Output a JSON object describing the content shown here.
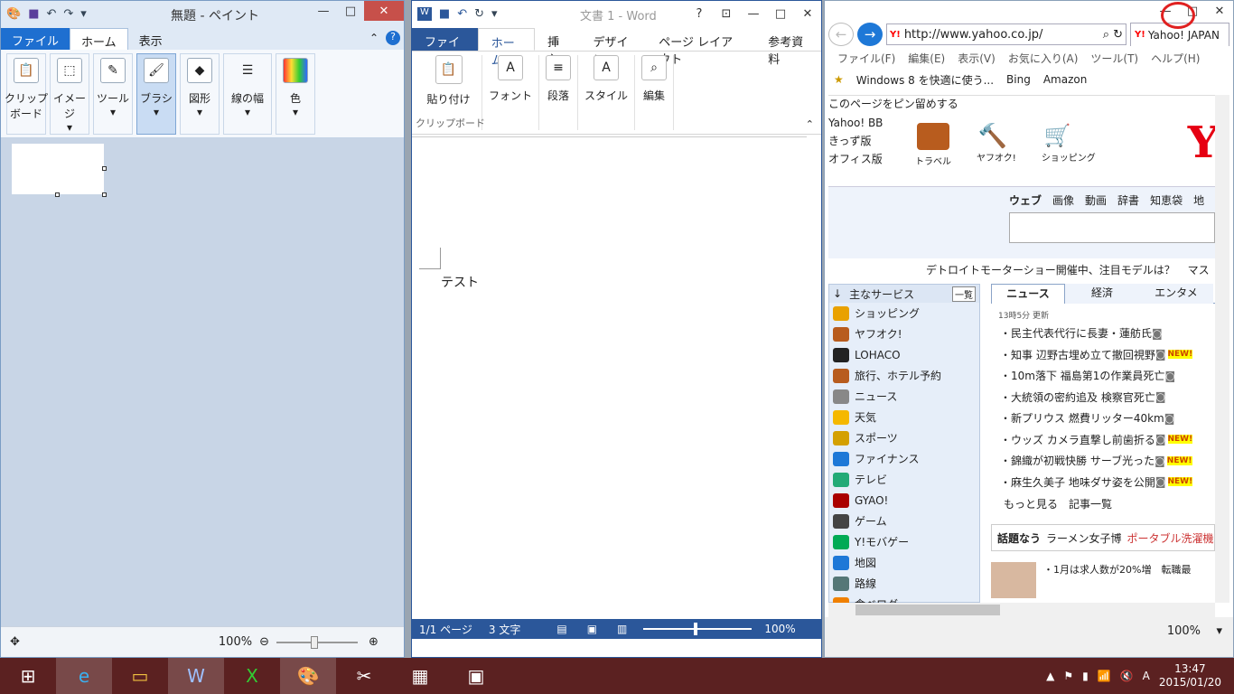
{
  "paint": {
    "title": "無題 - ペイント",
    "tabs": [
      "ファイル",
      "ホーム",
      "表示"
    ],
    "groups": [
      "クリップ\nボード",
      "イメージ",
      "ツール",
      "ブラシ",
      "図形",
      "線の幅",
      "色"
    ],
    "zoom": "100%"
  },
  "word": {
    "title": "文書 1 - Word",
    "help": "?",
    "tabs": [
      "ファイル",
      "ホーム",
      "挿入",
      "デザイン",
      "ページ レイアウト",
      "参考資料"
    ],
    "groups": [
      "貼り付け",
      "フォント",
      "段落",
      "スタイル",
      "編集"
    ],
    "clipboard_label": "クリップボード",
    "doc_text": "テスト",
    "page_status": "1/1 ページ",
    "word_count": "3 文字",
    "zoom": "100%"
  },
  "ie": {
    "url": "http://www.yahoo.co.jp/",
    "tab_title": "Yahoo! JAPAN",
    "menu": [
      "ファイル(F)",
      "編集(E)",
      "表示(V)",
      "お気に入り(A)",
      "ツール(T)",
      "ヘルプ(H)"
    ],
    "favorites": [
      "Windows 8 を快適に使う...",
      "Bing",
      "Amazon"
    ],
    "pin": "このページをピン留めする",
    "bb": [
      "Yahoo! BB",
      "きっず版",
      "オフィス版"
    ],
    "topicons": [
      "トラベル",
      "ヤフオク!",
      "ショッピング"
    ],
    "logo": "Y",
    "search_tabs": [
      "ウェブ",
      "画像",
      "動画",
      "辞書",
      "知恵袋",
      "地"
    ],
    "headline": "デトロイトモーターショー開催中、注目モデルは？",
    "headline2": "マス",
    "services_title": "主なサービス",
    "services_all": "一覧",
    "services": [
      "ショッピング",
      "ヤフオク!",
      "LOHACO",
      "旅行、ホテル予約",
      "ニュース",
      "天気",
      "スポーツ",
      "ファイナンス",
      "テレビ",
      "GYAO!",
      "ゲーム",
      "Y!モバゲー",
      "地図",
      "路線",
      "食べログ"
    ],
    "news_tabs": [
      "ニュース",
      "経済",
      "エンタメ"
    ],
    "news_time": "13時5分 更新",
    "news": [
      "民主代表代行に長妻・蓮舫氏",
      "知事 辺野古埋め立て撤回視野",
      "10m落下 福島第1の作業員死亡",
      "大統領の密約追及 検察官死亡",
      "新プリウス 燃費リッター40km",
      "ウッズ カメラ直撃し前歯折る",
      "錦織が初戦快勝 サーブ光った",
      "麻生久美子 地味ダサ姿を公開"
    ],
    "news_new": [
      false,
      true,
      false,
      false,
      false,
      true,
      true,
      true
    ],
    "new_label": "NEW!",
    "more": "もっと見る",
    "list": "記事一覧",
    "trend_label": "話題なう",
    "trend1": "ラーメン女子博",
    "trend2": "ポータブル洗濯機",
    "bottom_news": "・1月は求人数が20%増　転職最",
    "zoom": "100%"
  },
  "taskbar": {
    "time": "13:47",
    "date": "2015/01/20",
    "ime": "A"
  }
}
